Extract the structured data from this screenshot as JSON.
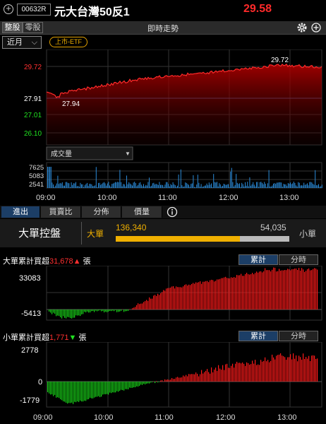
{
  "header": {
    "add_icon": "plus-circle-icon",
    "code": "00632R",
    "name": "元大台灣50反1",
    "price": "29.58"
  },
  "toolbar": {
    "seg1": "整股",
    "seg2": "零股",
    "title": "即時走勢",
    "settings_icon": "gear-icon",
    "add_icon": "plus-circle-icon"
  },
  "period": {
    "selected": "近月",
    "badge": "上市-ETF"
  },
  "price_chart": {
    "y_labels": [
      "29.72",
      "27.91",
      "27.01",
      "26.10"
    ],
    "high_label": "29.72",
    "low_label": "27.94",
    "volume_select": "成交量",
    "volume_labels": [
      "7625",
      "5083",
      "2541"
    ],
    "time_labels": [
      "09:00",
      "10:00",
      "11:00",
      "12:00",
      "13:00"
    ]
  },
  "tabs": [
    "進出",
    "買賣比",
    "分佈",
    "價量"
  ],
  "info_icon": "info-circle-icon",
  "big_control": {
    "title": "大單控盤",
    "big_label": "大單",
    "big_value": "136,340",
    "small_value": "54,035",
    "small_label": "小單",
    "big_share": 0.716
  },
  "big_cum": {
    "prefix": "大單累計買超",
    "value": "31,678",
    "unit": "張",
    "btn_cum": "累計",
    "btn_time": "分時",
    "y_labels": [
      "33083",
      "-5413"
    ]
  },
  "small_cum": {
    "prefix": "小單累計買超",
    "value": "1,771",
    "unit": "張",
    "btn_cum": "累計",
    "btn_time": "分時",
    "y_labels": [
      "2778",
      "0",
      "-1779"
    ],
    "time_labels": [
      "09:00",
      "10:00",
      "11:00",
      "12:00",
      "13:00"
    ]
  }
}
